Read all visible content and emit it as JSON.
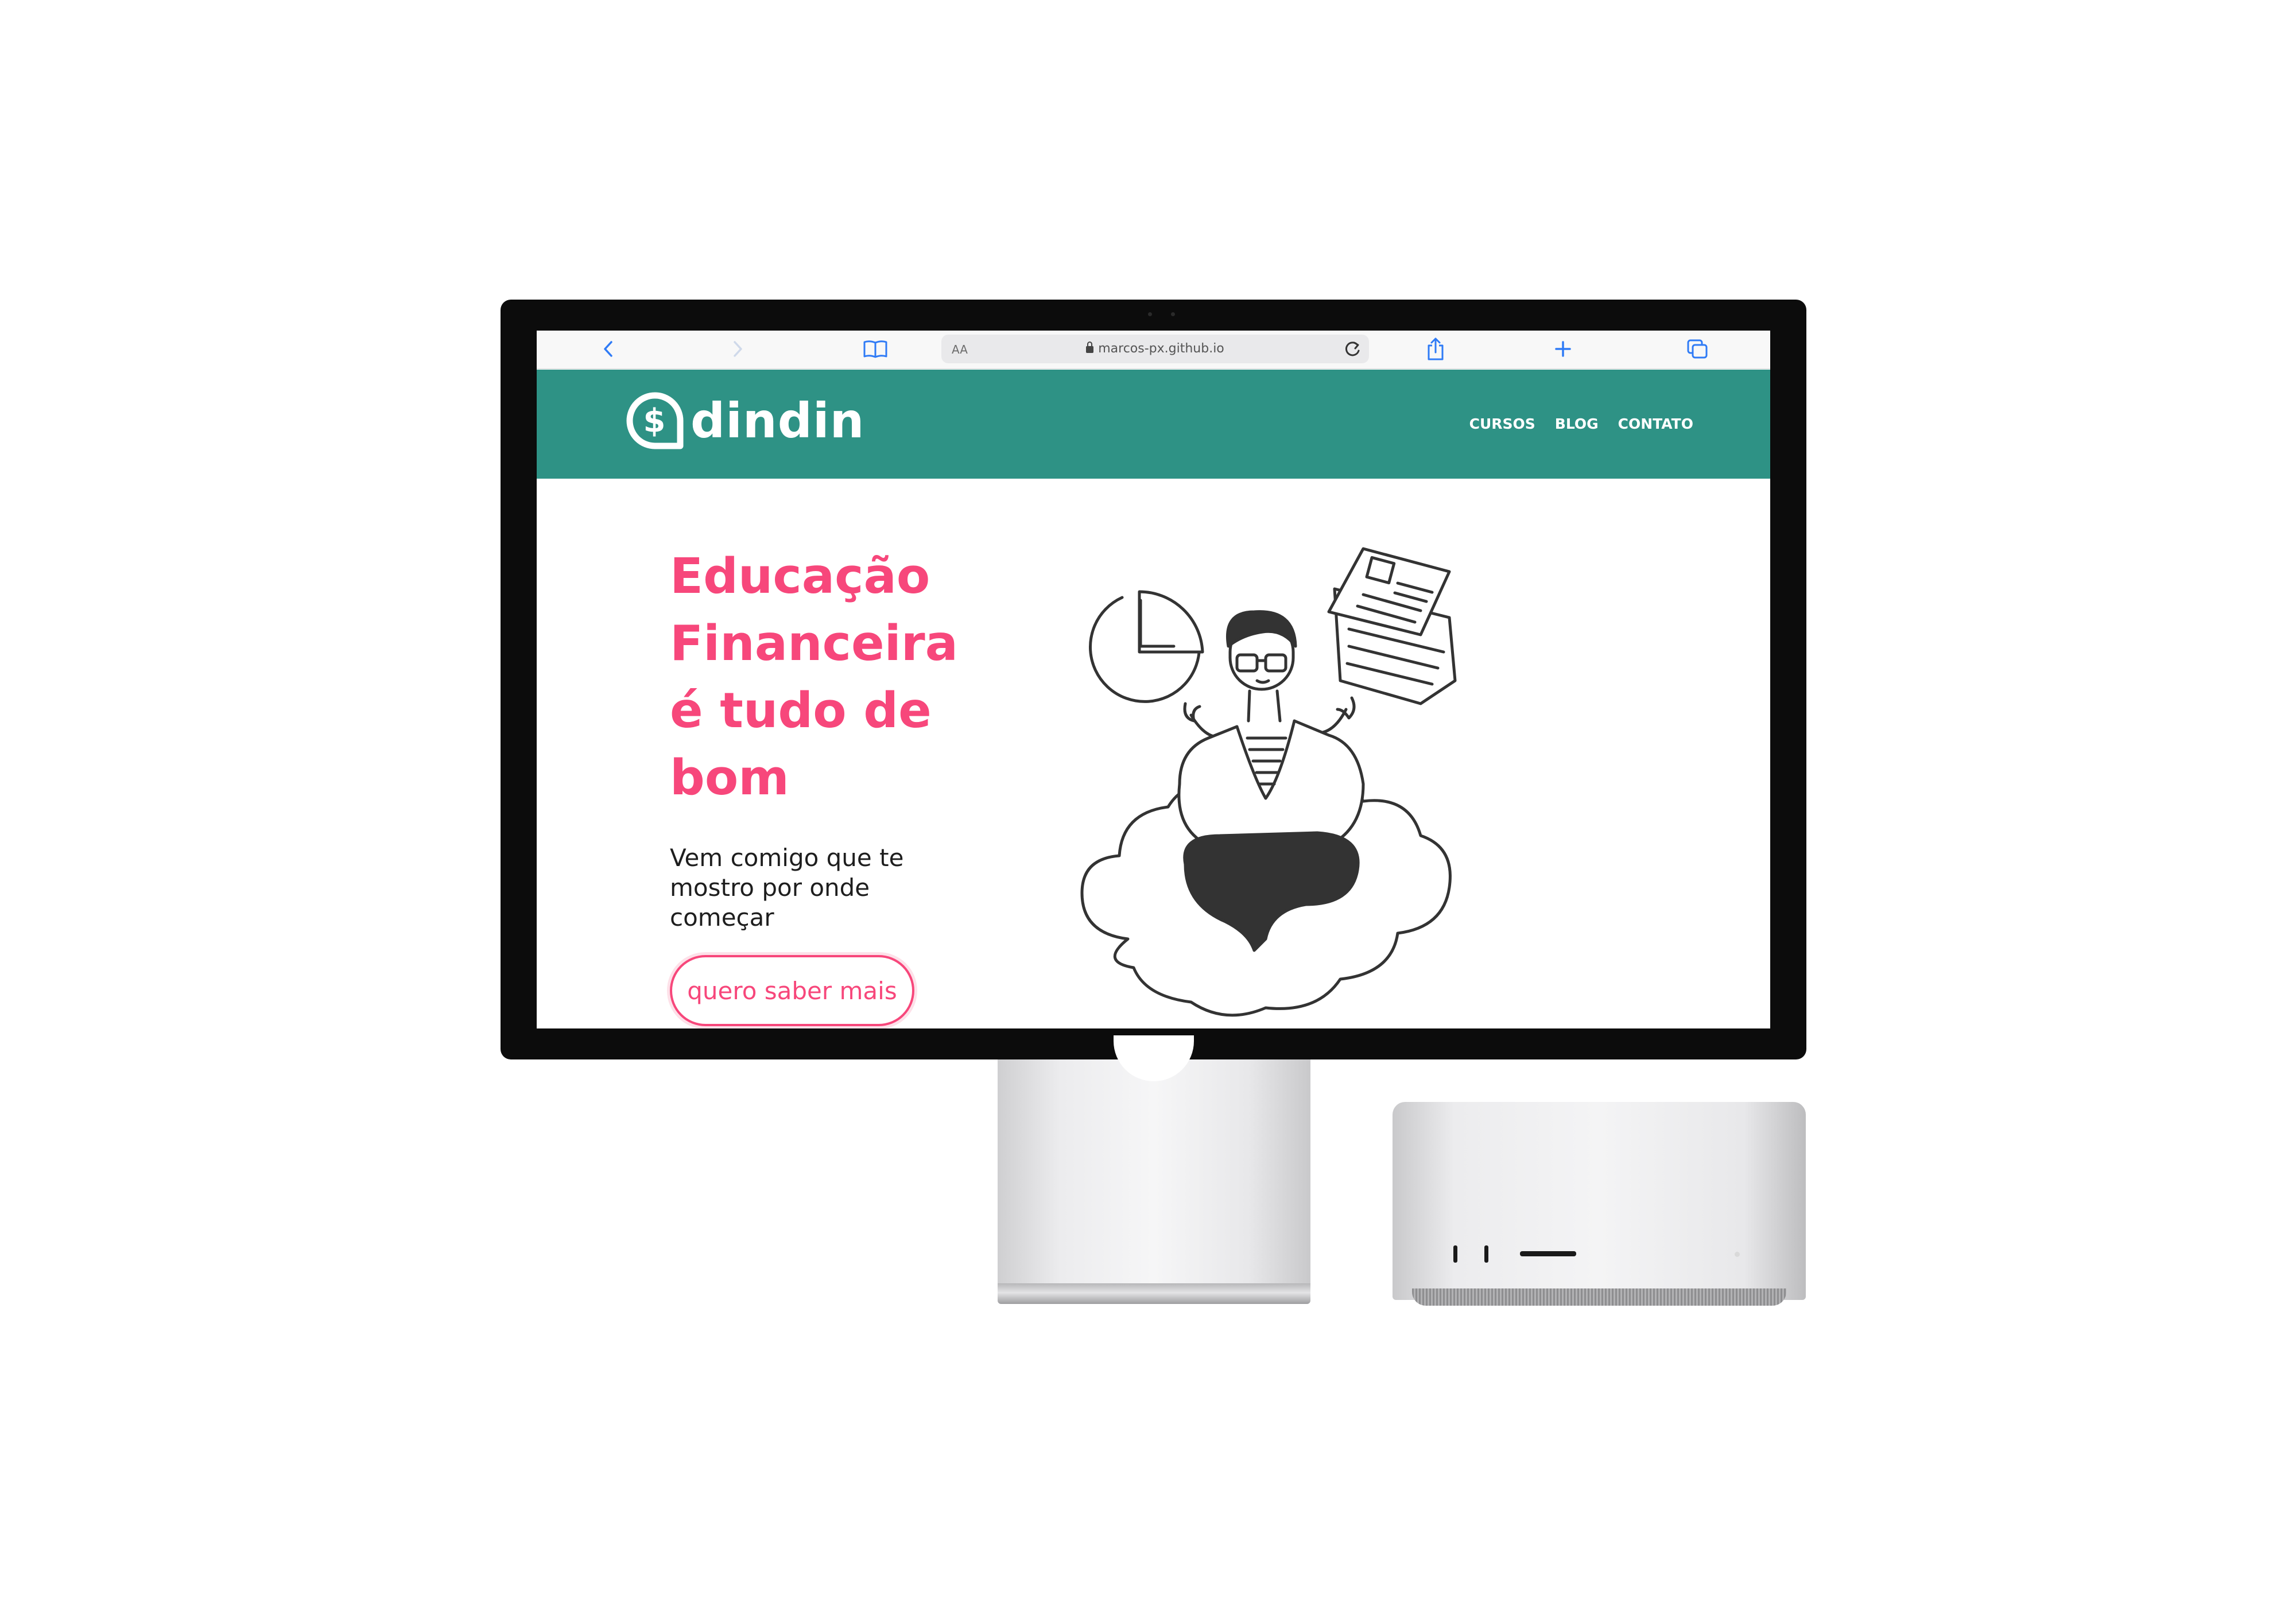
{
  "browser": {
    "url_text_size_label": "AA",
    "url": "marcos-px.github.io",
    "icons": [
      "back-icon",
      "forward-icon",
      "bookmarks-icon",
      "reload-icon",
      "share-icon",
      "new-tab-icon",
      "tabs-icon"
    ]
  },
  "site": {
    "logo_text": "dindin",
    "logo_symbol": "$",
    "nav": [
      "CURSOS",
      "BLOG",
      "CONTATO"
    ],
    "hero": {
      "title_lines": [
        "Educação",
        "Financeira",
        "é tudo de",
        "bom"
      ],
      "subtitle": "Vem comigo que te mostro por onde começar",
      "button_label": "quero saber mais"
    },
    "colors": {
      "header": "#2e9285",
      "accent_pink": "#f7477b",
      "header_text": "#ffffff"
    }
  }
}
